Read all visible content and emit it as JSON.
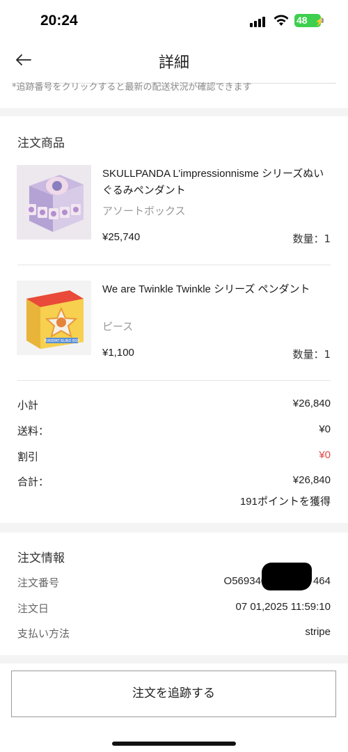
{
  "status_bar": {
    "time": "20:24",
    "battery": "48"
  },
  "nav": {
    "title": "詳細"
  },
  "note": "*追跡番号をクリックすると最新の配送状況が確認できます",
  "products": {
    "section_title": "注文商品",
    "items": [
      {
        "name": "SKULLPANDA L’impressionnisme シリーズぬいぐるみペンダント",
        "variant": "アソートボックス",
        "price": "¥25,740",
        "qty": "数量：1"
      },
      {
        "name": "We are Twinkle Twinkle シリーズ ペンダント",
        "variant": "ピース",
        "price": "¥1,100",
        "qty": "数量：1"
      }
    ],
    "box_label": "PUKEPAT BLIND BOX"
  },
  "summary": {
    "subtotal_label": "小計",
    "subtotal": "¥26,840",
    "shipping_label": "送料：",
    "shipping": "¥0",
    "discount_label": "割引",
    "discount": "¥0",
    "total_label": "合計：",
    "total": "¥26,840",
    "points": "191ポイントを獲得"
  },
  "order_info": {
    "section_title": "注文情報",
    "order_no_label": "注文番号",
    "order_no": "O569340768          464",
    "order_date_label": "注文日",
    "order_date": "07 01,2025 11:59:10",
    "payment_label": "支払い方法",
    "payment": "stripe"
  },
  "track_button": "注文を追跡する",
  "colors": {
    "discount": "#e04848",
    "battery": "#3ecf4e"
  }
}
